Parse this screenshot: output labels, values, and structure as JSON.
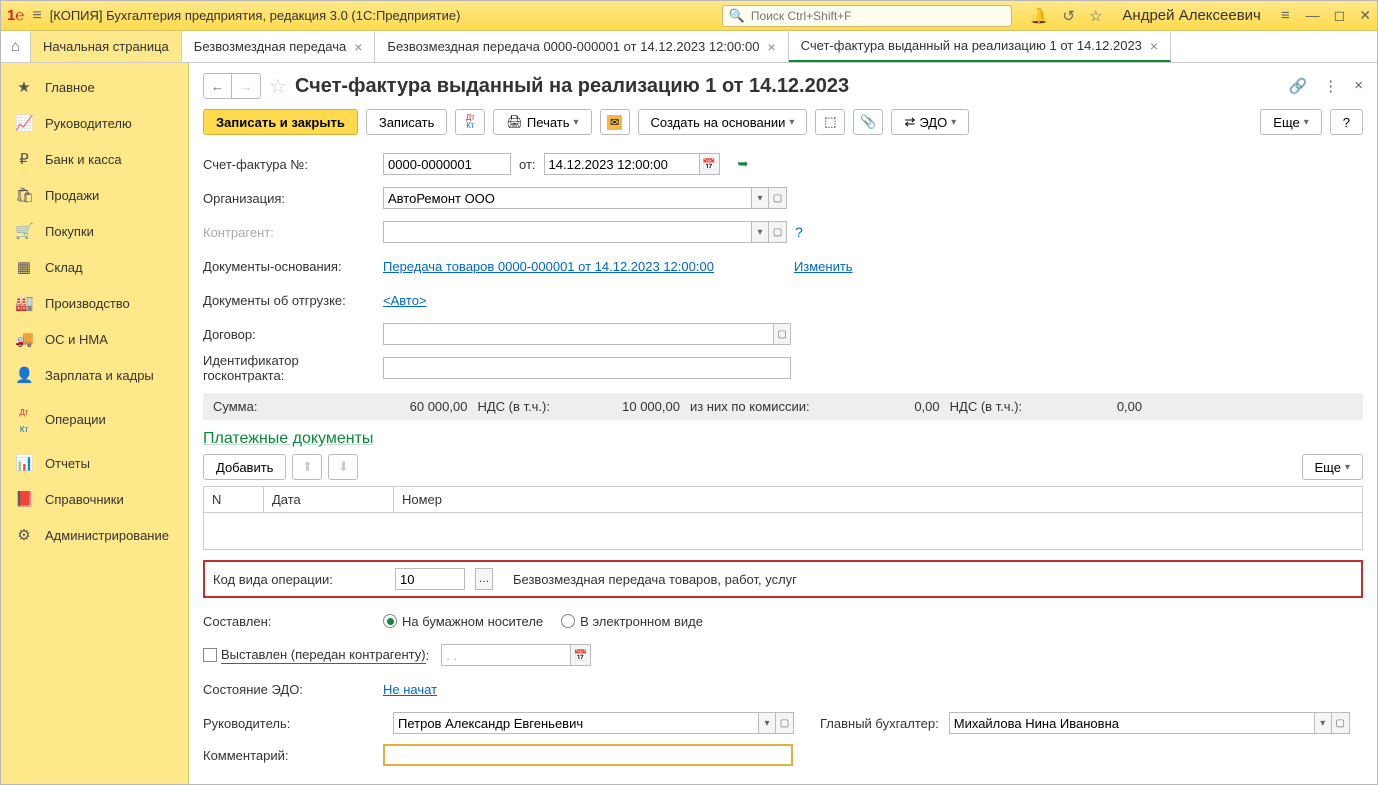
{
  "titlebar": {
    "app_title": "[КОПИЯ] Бухгалтерия предприятия, редакция 3.0  (1С:Предприятие)",
    "search_placeholder": "Поиск Ctrl+Shift+F",
    "username": "Андрей Алексеевич"
  },
  "tabs": {
    "start": "Начальная страница",
    "t1": "Безвозмездная передача",
    "t2": "Безвозмездная передача 0000-000001 от 14.12.2023 12:00:00",
    "t3": "Счет-фактура выданный на реализацию 1 от 14.12.2023"
  },
  "sidebar": {
    "items": [
      {
        "icon": "★",
        "label": "Главное"
      },
      {
        "icon": "📈",
        "label": "Руководителю"
      },
      {
        "icon": "₽",
        "label": "Банк и касса"
      },
      {
        "icon": "🛍",
        "label": "Продажи"
      },
      {
        "icon": "🛒",
        "label": "Покупки"
      },
      {
        "icon": "▦",
        "label": "Склад"
      },
      {
        "icon": "🏭",
        "label": "Производство"
      },
      {
        "icon": "🚚",
        "label": "ОС и НМА"
      },
      {
        "icon": "👤",
        "label": "Зарплата и кадры"
      },
      {
        "icon": "ᴰᵏ",
        "label": "Операции"
      },
      {
        "icon": "📊",
        "label": "Отчеты"
      },
      {
        "icon": "📕",
        "label": "Справочники"
      },
      {
        "icon": "⚙",
        "label": "Администрирование"
      }
    ]
  },
  "page": {
    "title": "Счет-фактура выданный на реализацию 1 от 14.12.2023"
  },
  "toolbar": {
    "save_close": "Записать и закрыть",
    "save": "Записать",
    "print": "Печать",
    "create_based": "Создать на основании",
    "edo": "ЭДО",
    "more": "Еще",
    "help": "?"
  },
  "form": {
    "sf_no_label": "Счет-фактура №:",
    "sf_no": "0000-0000001",
    "from": "от:",
    "date": "14.12.2023 12:00:00",
    "org_label": "Организация:",
    "org": "АвтоРемонт ООО",
    "counterparty_label": "Контрагент:",
    "basis_label": "Документы-основания:",
    "basis_link": "Передача товаров 0000-000001 от 14.12.2023 12:00:00",
    "basis_change": "Изменить",
    "shipping_label": "Документы об отгрузке:",
    "shipping_link": "<Авто>",
    "contract_label": "Договор:",
    "gos_label": "Идентификатор госконтракта:"
  },
  "summary": {
    "sum_label": "Сумма:",
    "sum": "60 000,00",
    "vat_label": "НДС (в т.ч.):",
    "vat": "10 000,00",
    "comm_label": "из них по комиссии:",
    "comm": "0,00",
    "vat2_label": "НДС (в т.ч.):",
    "vat2": "0,00"
  },
  "payments": {
    "title": "Платежные документы",
    "add": "Добавить",
    "more": "Еще",
    "cols": {
      "n": "N",
      "date": "Дата",
      "num": "Номер"
    }
  },
  "opcode": {
    "label": "Код вида операции:",
    "value": "10",
    "desc": "Безвозмездная передача товаров, работ, услуг"
  },
  "composed": {
    "label": "Составлен:",
    "paper": "На бумажном носителе",
    "electronic": "В электронном виде"
  },
  "issued": {
    "label": "Выставлен (передан контрагенту)",
    "date_placeholder": ".  ."
  },
  "edo_state": {
    "label": "Состояние ЭДО:",
    "link": "Не начат"
  },
  "manager": {
    "label": "Руководитель:",
    "value": "Петров Александр Евгеньевич"
  },
  "accountant": {
    "label": "Главный бухгалтер:",
    "value": "Михайлова Нина Ивановна"
  },
  "comment": {
    "label": "Комментарий:"
  }
}
